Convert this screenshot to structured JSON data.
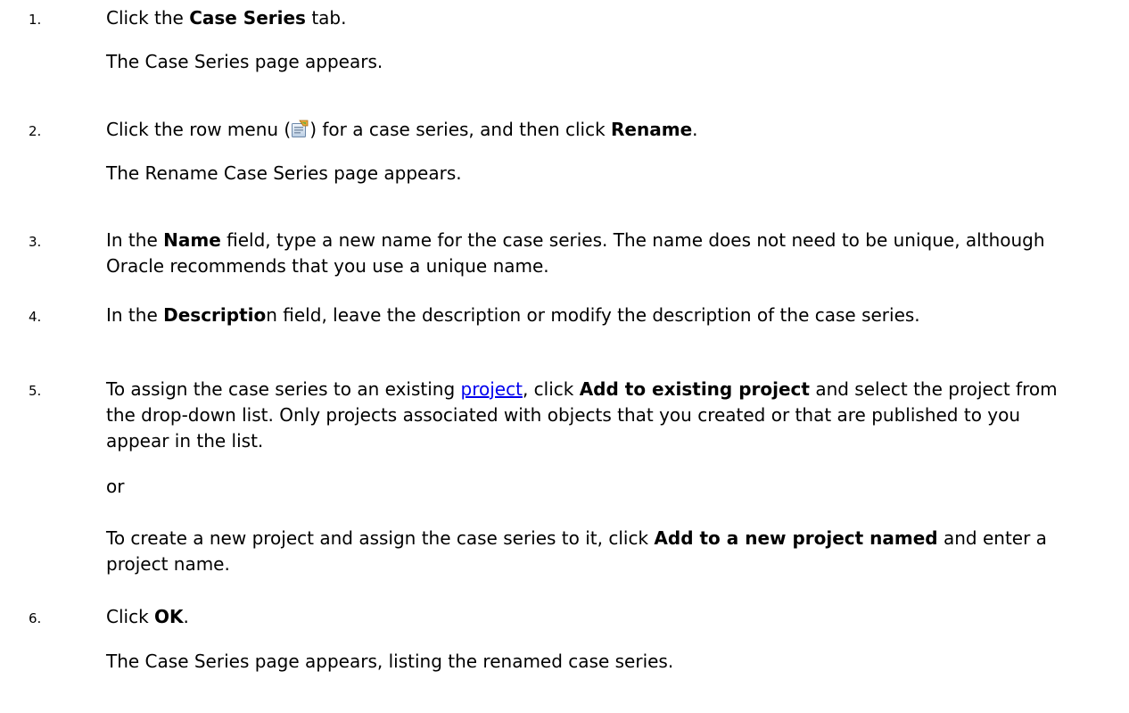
{
  "steps": [
    {
      "number": "1.",
      "parts": [
        "Click the ",
        "Case Series",
        " tab."
      ],
      "result": "The Case Series page appears."
    },
    {
      "number": "2.",
      "parts": [
        "Click the row menu (",
        ") for a case series, and then click ",
        "Rename",
        "."
      ],
      "icon": "row-menu-icon",
      "result": "The Rename Case Series page appears."
    },
    {
      "number": "3.",
      "parts": [
        "In the ",
        "Name",
        " field, type a new name for the case series. The name does not need to be unique, although Oracle recommends that you use a unique name."
      ]
    },
    {
      "number": "4.",
      "parts": [
        "In the ",
        "Descriptio",
        "n field, leave the description or modify the description of the case series."
      ]
    },
    {
      "number": "5.",
      "parts": [
        "To assign the case series to an existing ",
        "project",
        ", click ",
        "Add to existing project",
        " and select the project from the drop-down list. Only projects associated with objects that you created or that are published to you appear in the list."
      ],
      "or": "or",
      "alt_parts": [
        "To create a new project and assign the case series to it, click ",
        "Add to a new project named",
        " and enter a project name."
      ]
    },
    {
      "number": "6.",
      "parts": [
        "Click ",
        "OK",
        "."
      ],
      "result": "The Case Series page appears, listing the renamed case series."
    }
  ],
  "colors": {
    "text": "#000000",
    "link": "#0000ee",
    "background": "#ffffff"
  }
}
